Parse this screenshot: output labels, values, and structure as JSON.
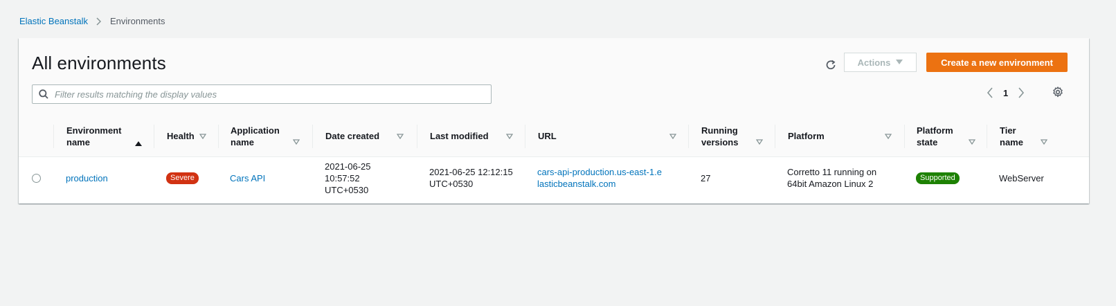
{
  "breadcrumb": {
    "root": "Elastic Beanstalk",
    "current": "Environments"
  },
  "panel": {
    "title": "All environments",
    "actions_label": "Actions",
    "create_label": "Create a new environment",
    "filter_placeholder": "Filter results matching the display values",
    "page": "1"
  },
  "table": {
    "headers": {
      "env_name": "Environment name",
      "health": "Health",
      "app_name": "Application name",
      "date_created": "Date created",
      "last_modified": "Last modified",
      "url": "URL",
      "running_versions": "Running versions",
      "platform": "Platform",
      "platform_state": "Platform state",
      "tier_name": "Tier name"
    },
    "rows": [
      {
        "env_name": "production",
        "health": "Severe",
        "app_name": "Cars API",
        "date_created": "2021-06-25 10:57:52 UTC+0530",
        "last_modified": "2021-06-25 12:12:15 UTC+0530",
        "url": "cars-api-production.us-east-1.elasticbeanstalk.com",
        "running_versions": "27",
        "platform": "Corretto 11 running on 64bit Amazon Linux 2",
        "platform_state": "Supported",
        "tier_name": "WebServer"
      }
    ]
  },
  "colors": {
    "link": "#0073bb",
    "primary_button": "#ec7211",
    "health_severe": "#d13212",
    "platform_supported": "#1d8102"
  },
  "icons": [
    "chevron-right-icon",
    "refresh-icon",
    "caret-down-icon",
    "search-icon",
    "chevron-left-icon",
    "gear-icon",
    "sort-ascending-icon",
    "sort-descending-icon"
  ]
}
